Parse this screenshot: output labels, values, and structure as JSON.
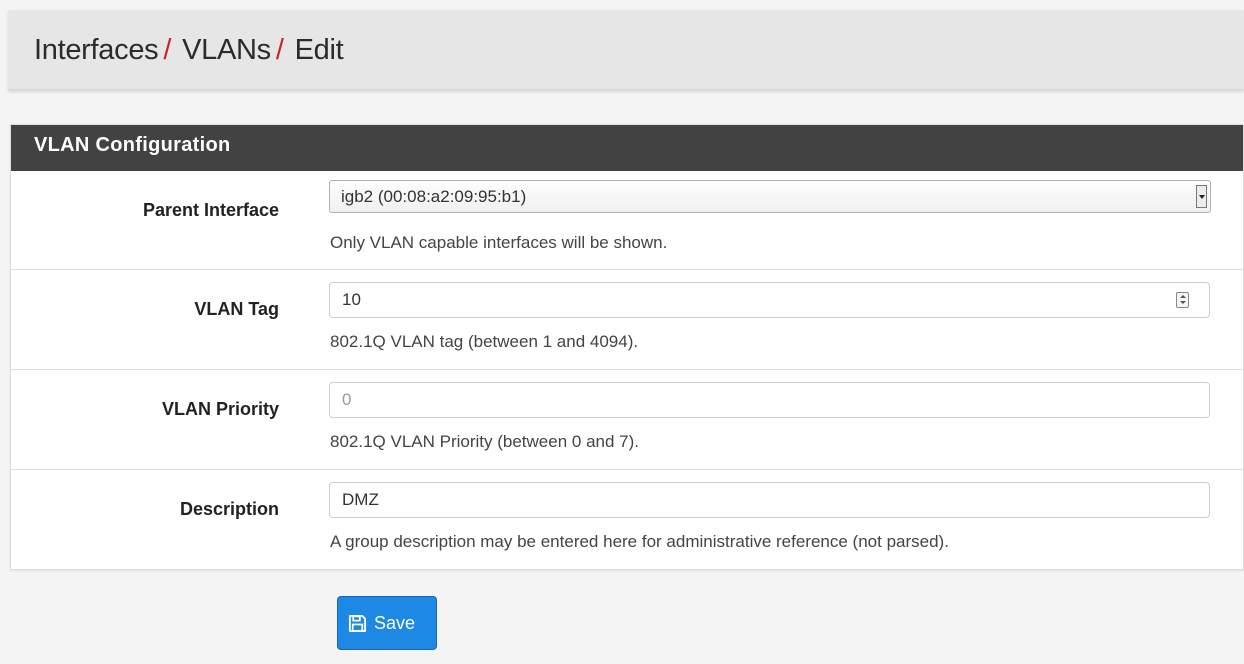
{
  "breadcrumb": {
    "items": [
      "Interfaces",
      "VLANs",
      "Edit"
    ],
    "separator": "/"
  },
  "panel": {
    "title": "VLAN Configuration"
  },
  "form": {
    "parent_interface": {
      "label": "Parent Interface",
      "selected": "igb2 (00:08:a2:09:95:b1)",
      "help": "Only VLAN capable interfaces will be shown."
    },
    "vlan_tag": {
      "label": "VLAN Tag",
      "value": "10",
      "help": "802.1Q VLAN tag (between 1 and 4094)."
    },
    "vlan_priority": {
      "label": "VLAN Priority",
      "placeholder": "0",
      "help": "802.1Q VLAN Priority (between 0 and 7)."
    },
    "description": {
      "label": "Description",
      "value": "DMZ",
      "help": "A group description may be entered here for administrative reference (not parsed)."
    }
  },
  "actions": {
    "save_label": "Save",
    "save_icon": "save-icon"
  },
  "colors": {
    "accent": "#1e88e5",
    "separator": "#c62828",
    "panel_header": "#424242"
  }
}
